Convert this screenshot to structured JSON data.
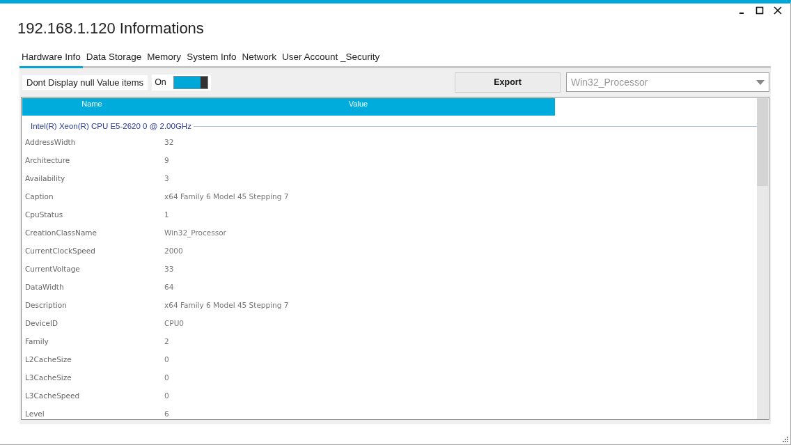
{
  "window": {
    "title": "192.168.1.120 Informations"
  },
  "tabs": [
    {
      "label": "Hardware Info",
      "selected": true
    },
    {
      "label": "Data Storage",
      "selected": false
    },
    {
      "label": "Memory",
      "selected": false
    },
    {
      "label": "System Info",
      "selected": false
    },
    {
      "label": "Network",
      "selected": false
    },
    {
      "label": "User Account _Security",
      "selected": false
    }
  ],
  "toolbar": {
    "null_filter": {
      "label": "Dont Display null Value items",
      "state_text": "On",
      "on": true
    },
    "export_button": "Export",
    "class_select": {
      "value": "Win32_Processor"
    }
  },
  "table": {
    "columns": [
      "Name",
      "Value"
    ],
    "group": "Intel(R) Xeon(R) CPU E5-2620 0 @ 2.00GHz",
    "rows": [
      {
        "name": "AddressWidth",
        "value": "32"
      },
      {
        "name": "Architecture",
        "value": "9"
      },
      {
        "name": "Availability",
        "value": "3"
      },
      {
        "name": "Caption",
        "value": "x64 Family 6 Model 45 Stepping 7"
      },
      {
        "name": "CpuStatus",
        "value": "1"
      },
      {
        "name": "CreationClassName",
        "value": "Win32_Processor"
      },
      {
        "name": "CurrentClockSpeed",
        "value": "2000"
      },
      {
        "name": "CurrentVoltage",
        "value": "33"
      },
      {
        "name": "DataWidth",
        "value": "64"
      },
      {
        "name": "Description",
        "value": "x64 Family 6 Model 45 Stepping 7"
      },
      {
        "name": "DeviceID",
        "value": "CPU0"
      },
      {
        "name": "Family",
        "value": "2"
      },
      {
        "name": "L2CacheSize",
        "value": "0"
      },
      {
        "name": "L3CacheSize",
        "value": "0"
      },
      {
        "name": "L3CacheSpeed",
        "value": "0"
      },
      {
        "name": "Level",
        "value": "6"
      }
    ]
  }
}
